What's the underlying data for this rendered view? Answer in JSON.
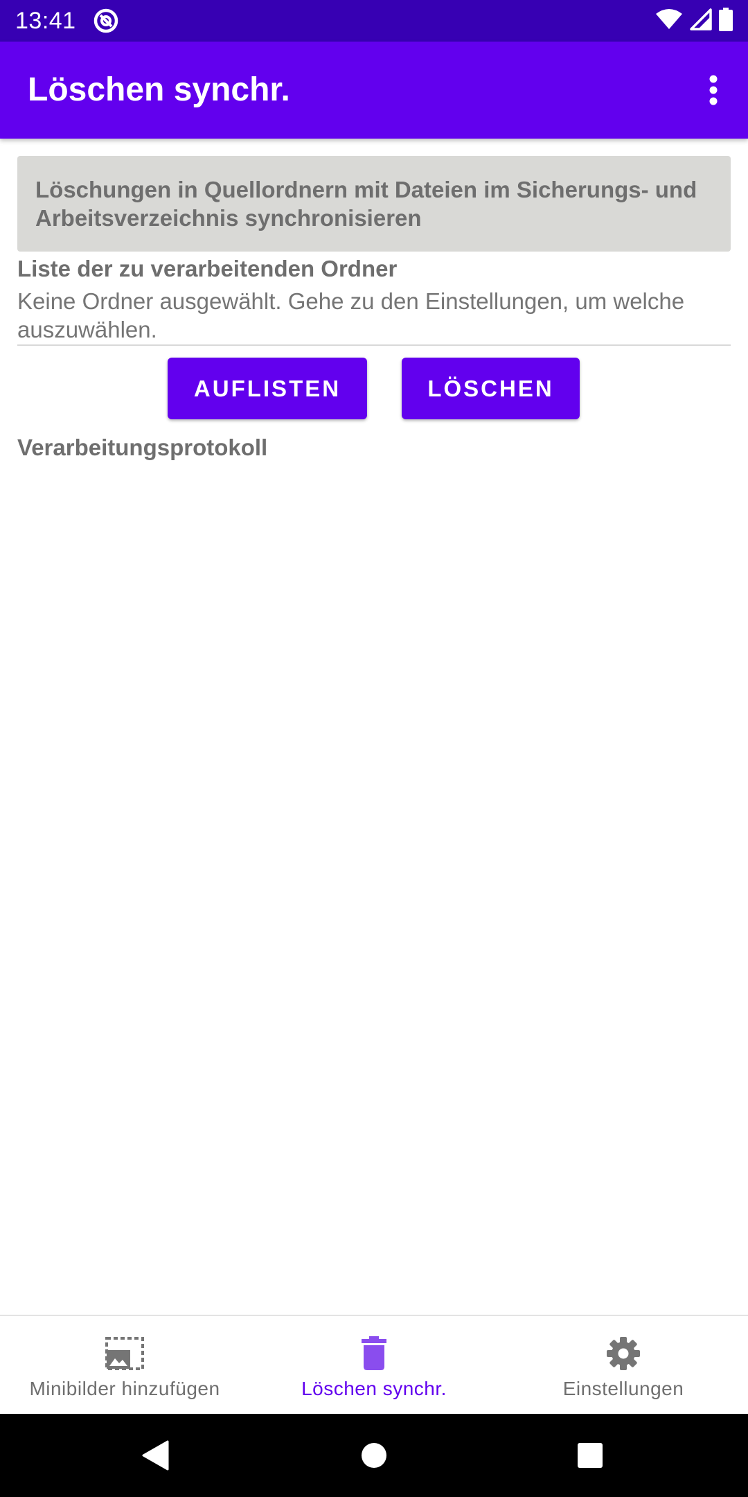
{
  "status_bar": {
    "time": "13:41",
    "left_icon": "at-sign-icon",
    "right_icons": [
      "wifi-icon",
      "cell-signal-icon",
      "battery-icon"
    ]
  },
  "app_bar": {
    "title": "Löschen synchr.",
    "menu_icon": "more-vert-icon"
  },
  "content": {
    "info_text": "Löschungen in Quellordnern mit Dateien im Sicherungs- und Arbeitsverzeichnis synchronisieren",
    "list_title": "Liste der zu verarbeitenden Ordner",
    "list_body": "Keine Ordner ausgewählt. Gehe zu den Einstellungen, um welche auszuwählen.",
    "buttons": {
      "list_label": "AUFLISTEN",
      "delete_label": "LÖSCHEN"
    },
    "log_title": "Verarbeitungsprotokoll"
  },
  "bottom_nav": {
    "items": [
      {
        "label": "Minibilder hinzufügen",
        "icon": "add-thumbnail-icon",
        "active": false
      },
      {
        "label": "Löschen synchr.",
        "icon": "trash-icon",
        "active": true
      },
      {
        "label": "Einstellungen",
        "icon": "gear-icon",
        "active": false
      }
    ]
  },
  "system_nav": {
    "icons": [
      "back-icon",
      "home-icon",
      "recents-icon"
    ]
  },
  "colors": {
    "status_bar": "#3700b3",
    "primary": "#6200ee",
    "info_box": "#d9d9d6",
    "active_nav": "#6200ee",
    "inactive_nav": "#6f6f6f"
  }
}
